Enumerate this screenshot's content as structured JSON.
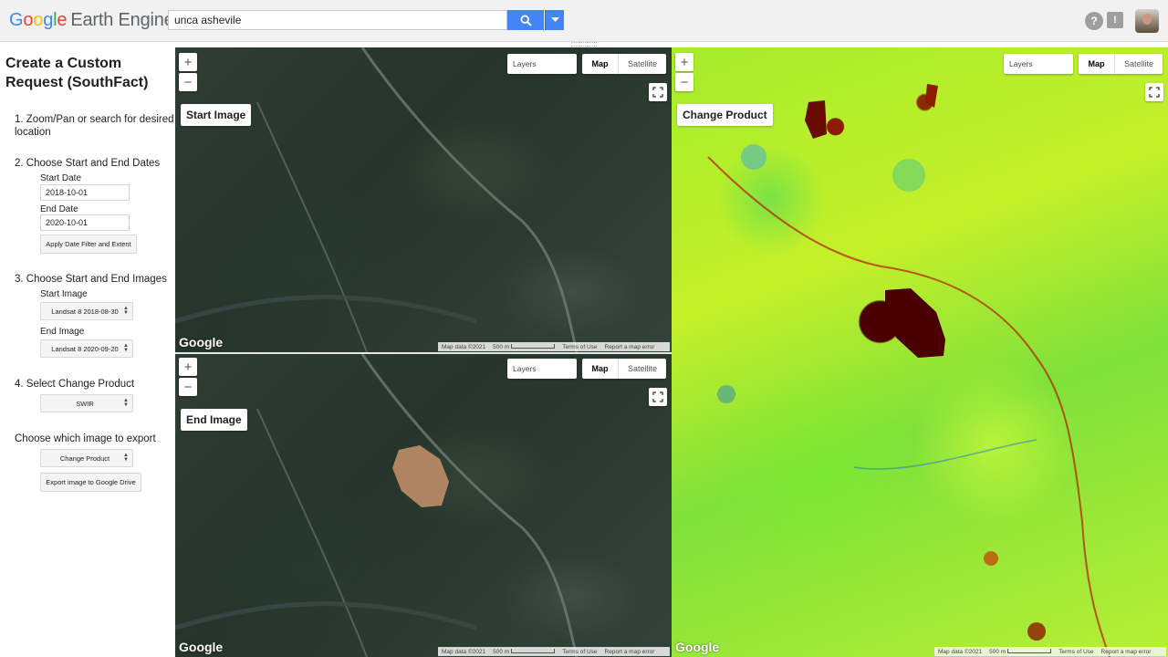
{
  "header": {
    "logo": {
      "part1": "G",
      "part2": "o",
      "part3": "o",
      "part4": "g",
      "part5": "l",
      "part6": "e",
      "product": "Earth Engine"
    },
    "search_value": "unca ashevile",
    "icons": [
      "search-icon",
      "dropdown-caret-icon",
      "help-icon",
      "feedback-icon",
      "avatar"
    ]
  },
  "panel": {
    "title": "Create a Custom Request (SouthFact)",
    "step1": "1. Zoom/Pan or search for desired location",
    "step2": "2. Choose Start and End Dates",
    "start_date_label": "Start Date",
    "start_date_value": "2018-10-01",
    "end_date_label": "End Date",
    "end_date_value": "2020-10-01",
    "apply_button": "Apply Date Filter and Extent",
    "step3": "3. Choose Start and End Images",
    "start_image_label": "Start Image",
    "start_image_value": "Landsat 8 2018-08-30",
    "end_image_label": "End Image",
    "end_image_value": "Landsat 8 2020-09-20",
    "step4": "4. Select Change Product",
    "product_value": "SWIR",
    "export_heading": "Choose which image to export",
    "export_select_value": "Change Product",
    "export_button": "Export image to Google Drive"
  },
  "maps": {
    "start": {
      "label": "Start Image",
      "layers": "Layers",
      "map_type_map": "Map",
      "map_type_satellite": "Satellite",
      "zoom_in": "+",
      "zoom_out": "−",
      "google": "Google",
      "map_data": "Map data ©2021",
      "scale": "500 m",
      "terms": "Terms of Use",
      "report": "Report a map error"
    },
    "end": {
      "label": "End Image",
      "layers": "Layers",
      "map_type_map": "Map",
      "map_type_satellite": "Satellite",
      "zoom_in": "+",
      "zoom_out": "−",
      "google": "Google",
      "map_data": "Map data ©2021",
      "scale": "500 m",
      "terms": "Terms of Use",
      "report": "Report a map error"
    },
    "change": {
      "label": "Change Product",
      "layers": "Layers",
      "map_type_map": "Map",
      "map_type_satellite": "Satellite",
      "zoom_in": "+",
      "zoom_out": "−",
      "google": "Google",
      "map_data": "Map data ©2021",
      "scale": "500 m",
      "terms": "Terms of Use",
      "report": "Report a map error"
    }
  },
  "colors": {
    "accent": "#4285f4",
    "change_high": "#4a0000",
    "change_low": "#a6ec2b"
  }
}
